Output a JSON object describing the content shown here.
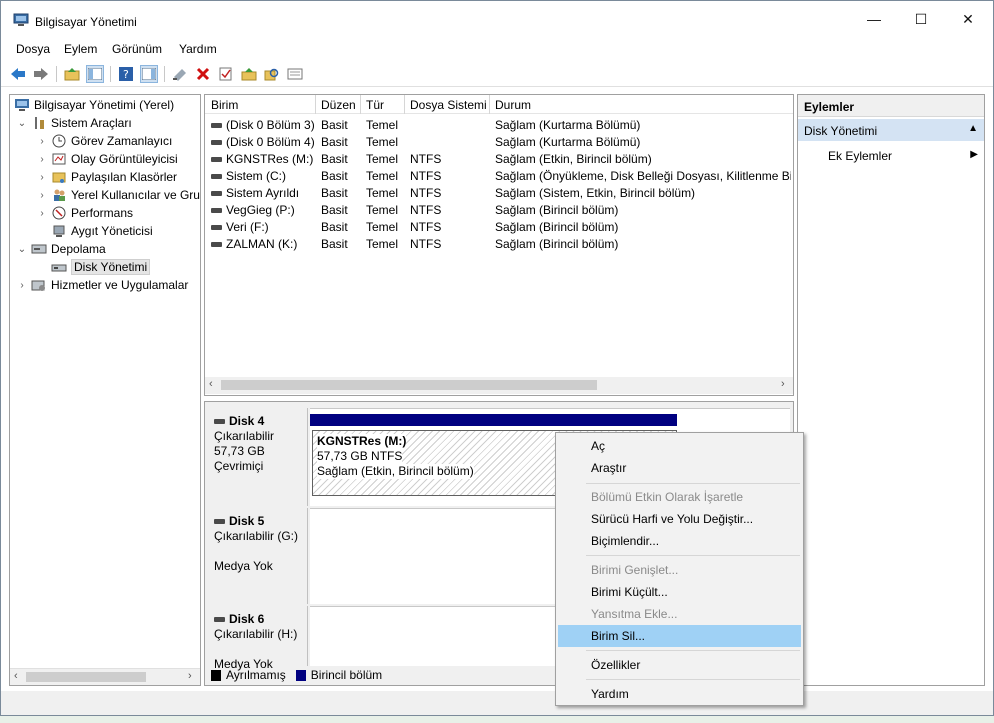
{
  "window": {
    "title": "Bilgisayar Yönetimi",
    "minimize": "—",
    "maximize": "☐",
    "close": "✕"
  },
  "menu": [
    "Dosya",
    "Eylem",
    "Görünüm",
    "Yardım"
  ],
  "tree": {
    "root": "Bilgisayar Yönetimi (Yerel)",
    "items": [
      {
        "label": "Sistem Araçları"
      },
      {
        "label": "Görev Zamanlayıcı"
      },
      {
        "label": "Olay Görüntüleyicisi"
      },
      {
        "label": "Paylaşılan Klasörler"
      },
      {
        "label": "Yerel Kullanıcılar ve Gru"
      },
      {
        "label": "Performans"
      },
      {
        "label": "Aygıt Yöneticisi"
      },
      {
        "label": "Depolama"
      },
      {
        "label": "Disk Yönetimi"
      },
      {
        "label": "Hizmetler ve Uygulamalar"
      }
    ]
  },
  "volumes": {
    "columns": [
      "Birim",
      "Düzen",
      "Tür",
      "Dosya Sistemi",
      "Durum"
    ],
    "rows": [
      [
        "(Disk 0 Bölüm 3)",
        "Basit",
        "Temel",
        "",
        "Sağlam (Kurtarma Bölümü)"
      ],
      [
        "(Disk 0 Bölüm 4)",
        "Basit",
        "Temel",
        "",
        "Sağlam (Kurtarma Bölümü)"
      ],
      [
        "KGNSTRes (M:)",
        "Basit",
        "Temel",
        "NTFS",
        "Sağlam (Etkin, Birincil bölüm)"
      ],
      [
        "Sistem (C:)",
        "Basit",
        "Temel",
        "NTFS",
        "Sağlam (Önyükleme, Disk Belleği Dosyası, Kilitlenme Bilg"
      ],
      [
        "Sistem Ayrıldı",
        "Basit",
        "Temel",
        "NTFS",
        "Sağlam (Sistem, Etkin, Birincil bölüm)"
      ],
      [
        "VegGieg (P:)",
        "Basit",
        "Temel",
        "NTFS",
        "Sağlam (Birincil bölüm)"
      ],
      [
        "Veri (F:)",
        "Basit",
        "Temel",
        "NTFS",
        "Sağlam (Birincil bölüm)"
      ],
      [
        "ZALMAN (K:)",
        "Basit",
        "Temel",
        "NTFS",
        "Sağlam (Birincil bölüm)"
      ]
    ]
  },
  "disks": [
    {
      "name": "Disk 4",
      "type": "Çıkarılabilir",
      "size": "57,73 GB",
      "status": "Çevrimiçi"
    },
    {
      "name": "Disk 5",
      "type": "Çıkarılabilir (G:)",
      "size": "",
      "status": "Medya Yok"
    },
    {
      "name": "Disk 6",
      "type": "Çıkarılabilir (H:)",
      "size": "",
      "status": "Medya Yok"
    }
  ],
  "partition": {
    "name": "KGNSTRes  (M:)",
    "size": "57,73 GB NTFS",
    "status": "Sağlam (Etkin, Birincil bölüm)"
  },
  "legend": [
    {
      "label": "Ayrılmamış",
      "color": "#000000"
    },
    {
      "label": "Birincil bölüm",
      "color": "#000080"
    }
  ],
  "actions": {
    "header": "Eylemler",
    "section": "Disk Yönetimi",
    "more": "Ek Eylemler"
  },
  "context_menu": [
    {
      "label": "Aç",
      "disabled": false
    },
    {
      "label": "Araştır",
      "disabled": false
    },
    {
      "label": "Bölümü Etkin Olarak İşaretle",
      "disabled": true
    },
    {
      "label": "Sürücü Harfi ve Yolu Değiştir...",
      "disabled": false
    },
    {
      "label": "Biçimlendir...",
      "disabled": false
    },
    {
      "label": "Birimi Genişlet...",
      "disabled": true
    },
    {
      "label": "Birimi Küçült...",
      "disabled": false
    },
    {
      "label": "Yansıtma Ekle...",
      "disabled": true
    },
    {
      "label": "Birim Sil...",
      "disabled": false,
      "highlighted": true
    },
    {
      "label": "Özellikler",
      "disabled": false
    },
    {
      "label": "Yardım",
      "disabled": false
    }
  ]
}
